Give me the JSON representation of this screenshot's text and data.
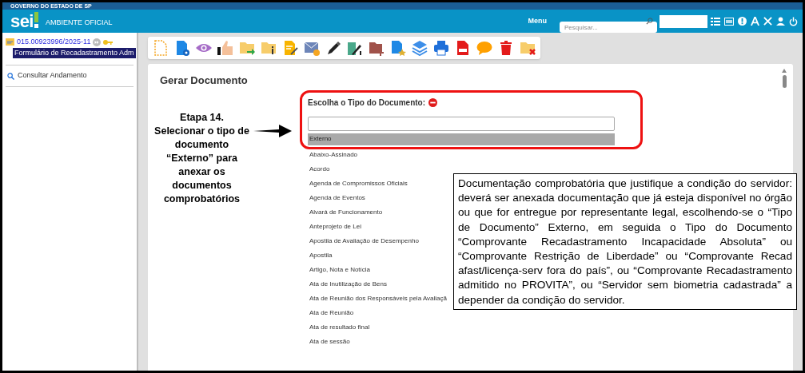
{
  "header": {
    "government": "GOVERNO DO ESTADO DE SP",
    "logo": "sei",
    "environment": "AMBIENTE OFICIAL",
    "menu": "Menu",
    "search": {
      "placeholder": "Pesquisar..."
    }
  },
  "tree": {
    "process": "015.00923996/2025-11",
    "children": [
      {
        "label": "Formulário de Recadastramento Adm",
        "selected": true
      }
    ]
  },
  "sidebar": {
    "items": [
      "Consultar Andamento"
    ]
  },
  "panel": {
    "title": "Gerar Documento",
    "field_label": "Escolha o Tipo do Documento:",
    "options": [
      {
        "label": "Externo",
        "selected": true
      },
      {
        "label": "Abaixo-Assinado",
        "selected": false
      },
      {
        "label": "Acordo",
        "selected": false
      },
      {
        "label": "Agenda de Compromissos Oficiais",
        "selected": false
      },
      {
        "label": "Agenda de Eventos",
        "selected": false
      },
      {
        "label": "Alvará de Funcionamento",
        "selected": false
      },
      {
        "label": "Anteprojeto de Lei",
        "selected": false
      },
      {
        "label": "Apostila de Avaliação de Desempenho",
        "selected": false
      },
      {
        "label": "Apostila",
        "selected": false
      },
      {
        "label": "Artigo, Nota e Notícia",
        "selected": false
      },
      {
        "label": "Ata de Inutilização de Bens",
        "selected": false
      },
      {
        "label": "Ata de Reunião dos Responsáveis pela Avaliaçã",
        "selected": false
      },
      {
        "label": "Ata de Reunião",
        "selected": false
      },
      {
        "label": "Ata de resultado final",
        "selected": false
      },
      {
        "label": "Ata de sessão",
        "selected": false
      }
    ]
  },
  "annotations": {
    "step": "Etapa 14.\nSelecionar o tipo de\ndocumento\n“Externo” para\nanexar os\ndocumentos\ncomprobatórios",
    "note": "Documentação comprobatória que justifique a condição do servidor: deverá ser anexada documentação que já esteja disponível no órgão ou que for entregue por representante legal, escolhendo-se o “Tipo de Documento” Externo, em seguida o Tipo do Documento “Comprovante Recadastramento Incapacidade Absoluta” ou “Comprovante Restrição de Liberdade” ou “Comprovante Recad afast/licença-serv fora do país”, ou “Comprovante Recadastramento admitido no PROVITA”, ou “Servidor sem biometria cadastrada” a depender da condição do servidor."
  }
}
